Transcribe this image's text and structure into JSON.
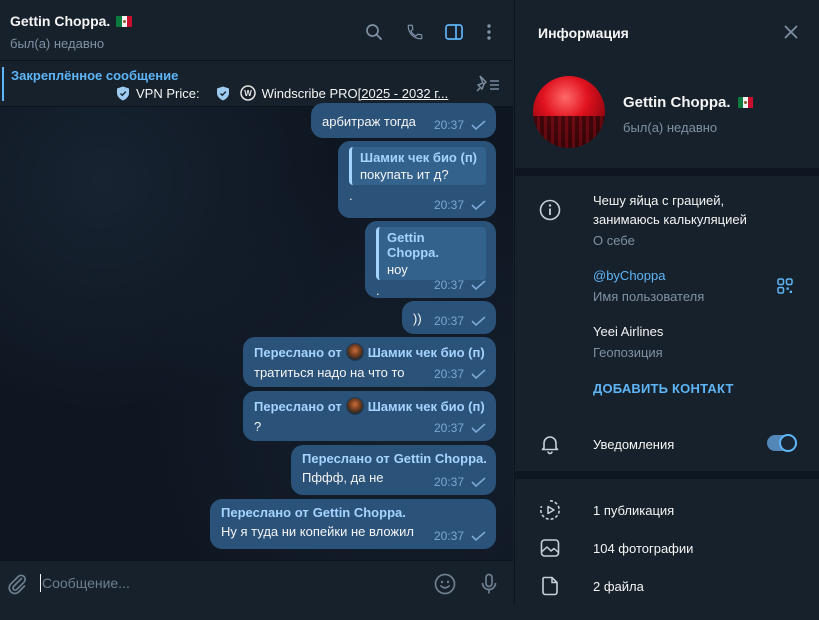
{
  "chat": {
    "title": "Gettin Choppa.",
    "status": "был(а) недавно",
    "pinned": {
      "title": "Закреплённое сообщение",
      "price_label": "VPN Price:",
      "service": "Windscribe PRO",
      "link_text": "[2025 - 2032 г..."
    },
    "messages": [
      {
        "text": "арбитраж тогда",
        "time": "20:37"
      },
      {
        "quote_name": "Шамик чек био (п)",
        "quote_text": "покупать ит д?",
        "text": ".",
        "time": "20:37"
      },
      {
        "quote_name": "Gettin Choppa.",
        "quote_text": "ноу",
        "text": ".",
        "time": "20:37"
      },
      {
        "text": "))",
        "time": "20:37"
      },
      {
        "forward_prefix": "Переслано от",
        "forward_name": "Шамик чек био (п)",
        "text": "тратиться надо на что то",
        "time": "20:37"
      },
      {
        "forward_prefix": "Переслано от",
        "forward_name": "Шамик чек био (п)",
        "text": "?",
        "time": "20:37"
      },
      {
        "forward_prefix": "Переслано от",
        "forward_name": "Gettin Choppa.",
        "text": "Пффф, да не",
        "time": "20:37"
      },
      {
        "forward_prefix": "Переслано от",
        "forward_name": "Gettin Choppa.",
        "text": "Ну я туда ни копейки не вложил",
        "time": "20:37"
      }
    ],
    "composer_placeholder": "Сообщение..."
  },
  "info": {
    "title": "Информация",
    "name": "Gettin Choppa.",
    "status": "был(а) недавно",
    "bio_line1": "Чешу яйца с грацией,",
    "bio_line2": "занимаюсь калькуляцией",
    "bio_label": "О себе",
    "username": "@byChoppa",
    "username_label": "Имя пользователя",
    "location": "Yeei Airlines",
    "location_label": "Геопозиция",
    "add_contact": "ДОБАВИТЬ КОНТАКТ",
    "notifications": "Уведомления",
    "notifications_on": true,
    "media": [
      {
        "icon": "stories-icon",
        "label": "1 публикация"
      },
      {
        "icon": "photo-icon",
        "label": "104 фотографии"
      },
      {
        "icon": "file-icon",
        "label": "2 файла"
      }
    ]
  },
  "colors": {
    "accent": "#5eb5f7",
    "bubble_out": "#2b5278",
    "panel": "#17212b",
    "chat_bg": "#0e1621",
    "muted": "#7f91a4"
  }
}
